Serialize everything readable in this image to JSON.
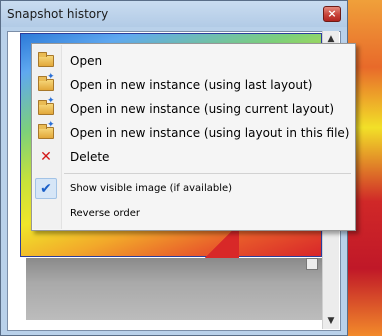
{
  "window": {
    "title": "Snapshot history",
    "close_glyph": "×"
  },
  "scrollbar": {
    "up_glyph": "▲",
    "down_glyph": "▼"
  },
  "menu": {
    "items": [
      {
        "label": "Open",
        "icon": "folder-open-icon"
      },
      {
        "label": "Open in new instance (using last layout)",
        "icon": "folder-open-new-icon"
      },
      {
        "label": "Open in new instance (using current layout)",
        "icon": "folder-open-new-icon"
      },
      {
        "label": "Open in new instance (using layout in this file)",
        "icon": "folder-open-new-icon"
      },
      {
        "label": "Delete",
        "icon": "delete-icon",
        "glyph": "✕"
      }
    ],
    "options": [
      {
        "label": "Show visible image (if available)",
        "checked": true,
        "glyph": "✔"
      },
      {
        "label": "Reverse order",
        "checked": false
      }
    ]
  },
  "colors": {
    "delete": "#d21919",
    "check": "#1a5fc8",
    "selection_border": "#2b3d9c"
  }
}
